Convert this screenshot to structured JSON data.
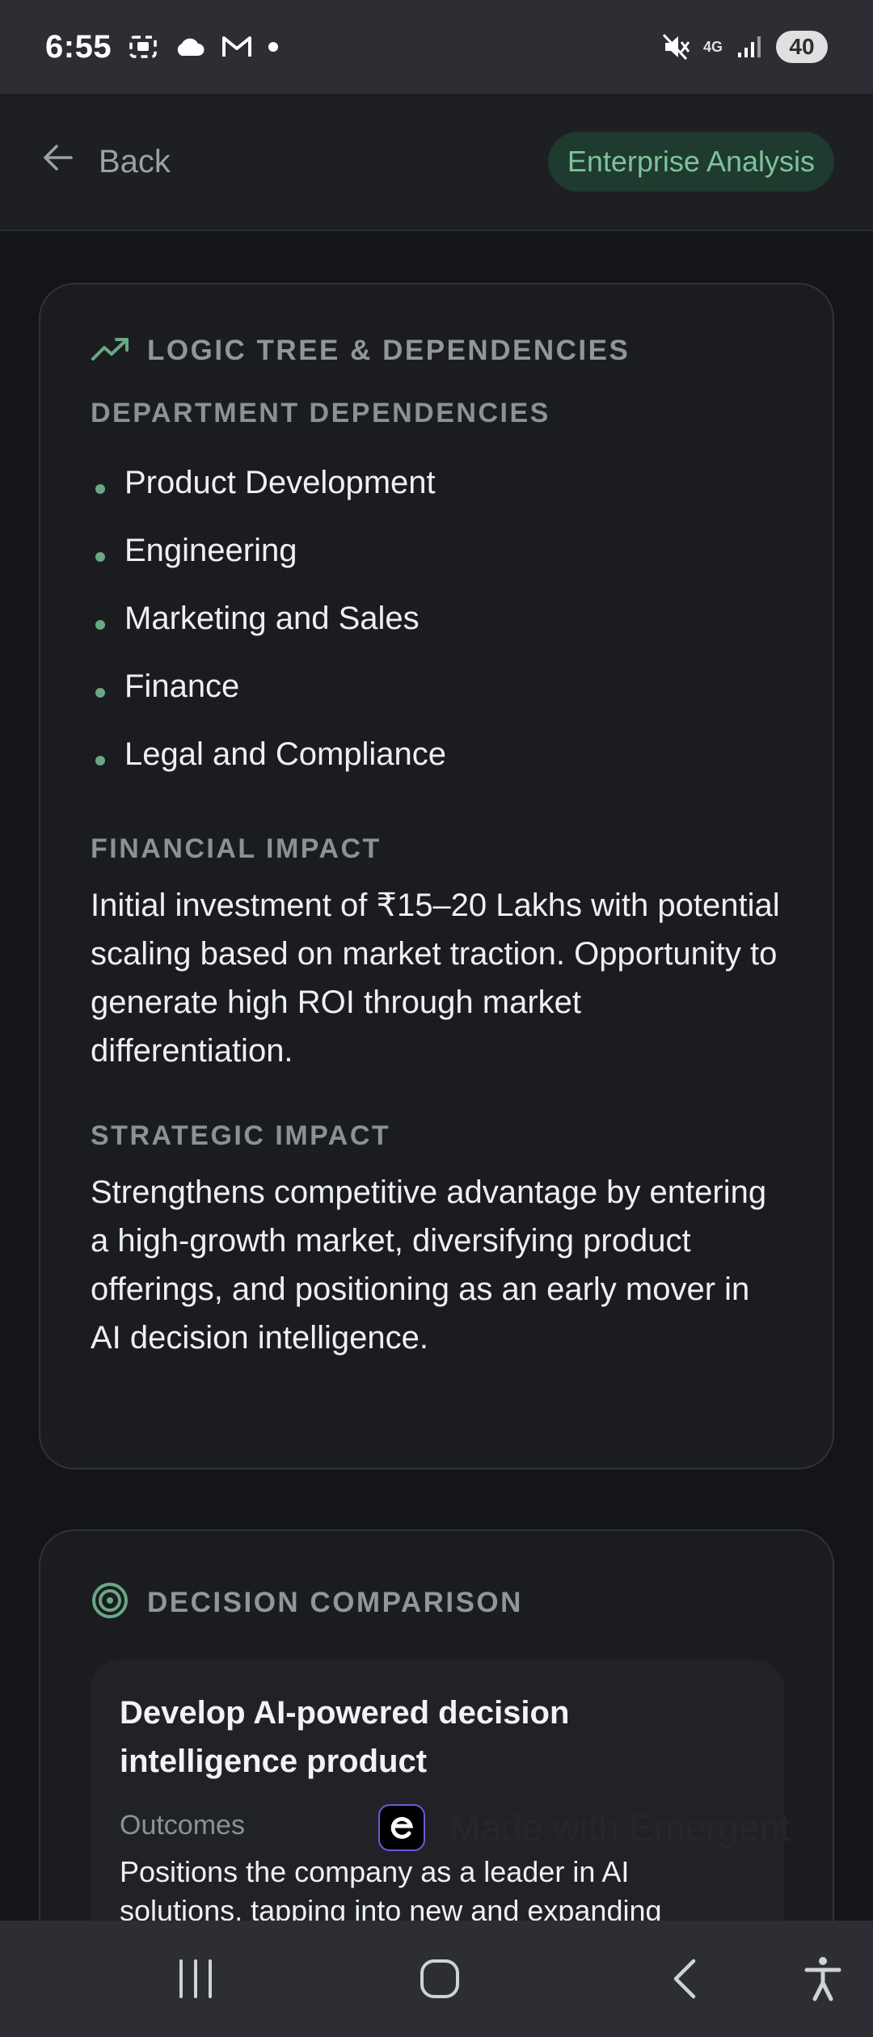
{
  "status_bar": {
    "time": "6:55",
    "network": "4G",
    "battery": "40",
    "icons": [
      "screenshot-icon",
      "cloud-icon",
      "gmail-icon",
      "dot-icon",
      "mute-icon",
      "signal-icon"
    ]
  },
  "header": {
    "back_label": "Back",
    "badge_label": "Enterprise Analysis"
  },
  "logic_tree": {
    "title": "LOGIC TREE & DEPENDENCIES",
    "departments": {
      "title": "DEPARTMENT DEPENDENCIES",
      "items": [
        "Product Development",
        "Engineering",
        "Marketing and Sales",
        "Finance",
        "Legal and Compliance"
      ]
    },
    "financial": {
      "title": "FINANCIAL IMPACT",
      "text": "Initial investment of ₹15–20 Lakhs with potential scaling based on market traction. Opportunity to generate high ROI through market differentiation."
    },
    "strategic": {
      "title": "STRATEGIC IMPACT",
      "text": "Strengthens competitive advantage by entering a high-growth market, diversifying product offerings, and positioning as an early mover in AI decision intelligence."
    }
  },
  "decision_comparison": {
    "title": "DECISION COMPARISON",
    "option": {
      "title": "Develop AI-powered decision intelligence product",
      "outcomes_label": "Outcomes",
      "outcomes_text": "Positions the company as a leader in AI solutions, tapping into new and expanding"
    }
  },
  "watermark": {
    "text": "Made with Emergent"
  },
  "colors": {
    "accent_green": "#6aa884",
    "badge_bg": "#1f3a2e",
    "card_bg": "#1b1c20",
    "page_bg": "#141518"
  }
}
